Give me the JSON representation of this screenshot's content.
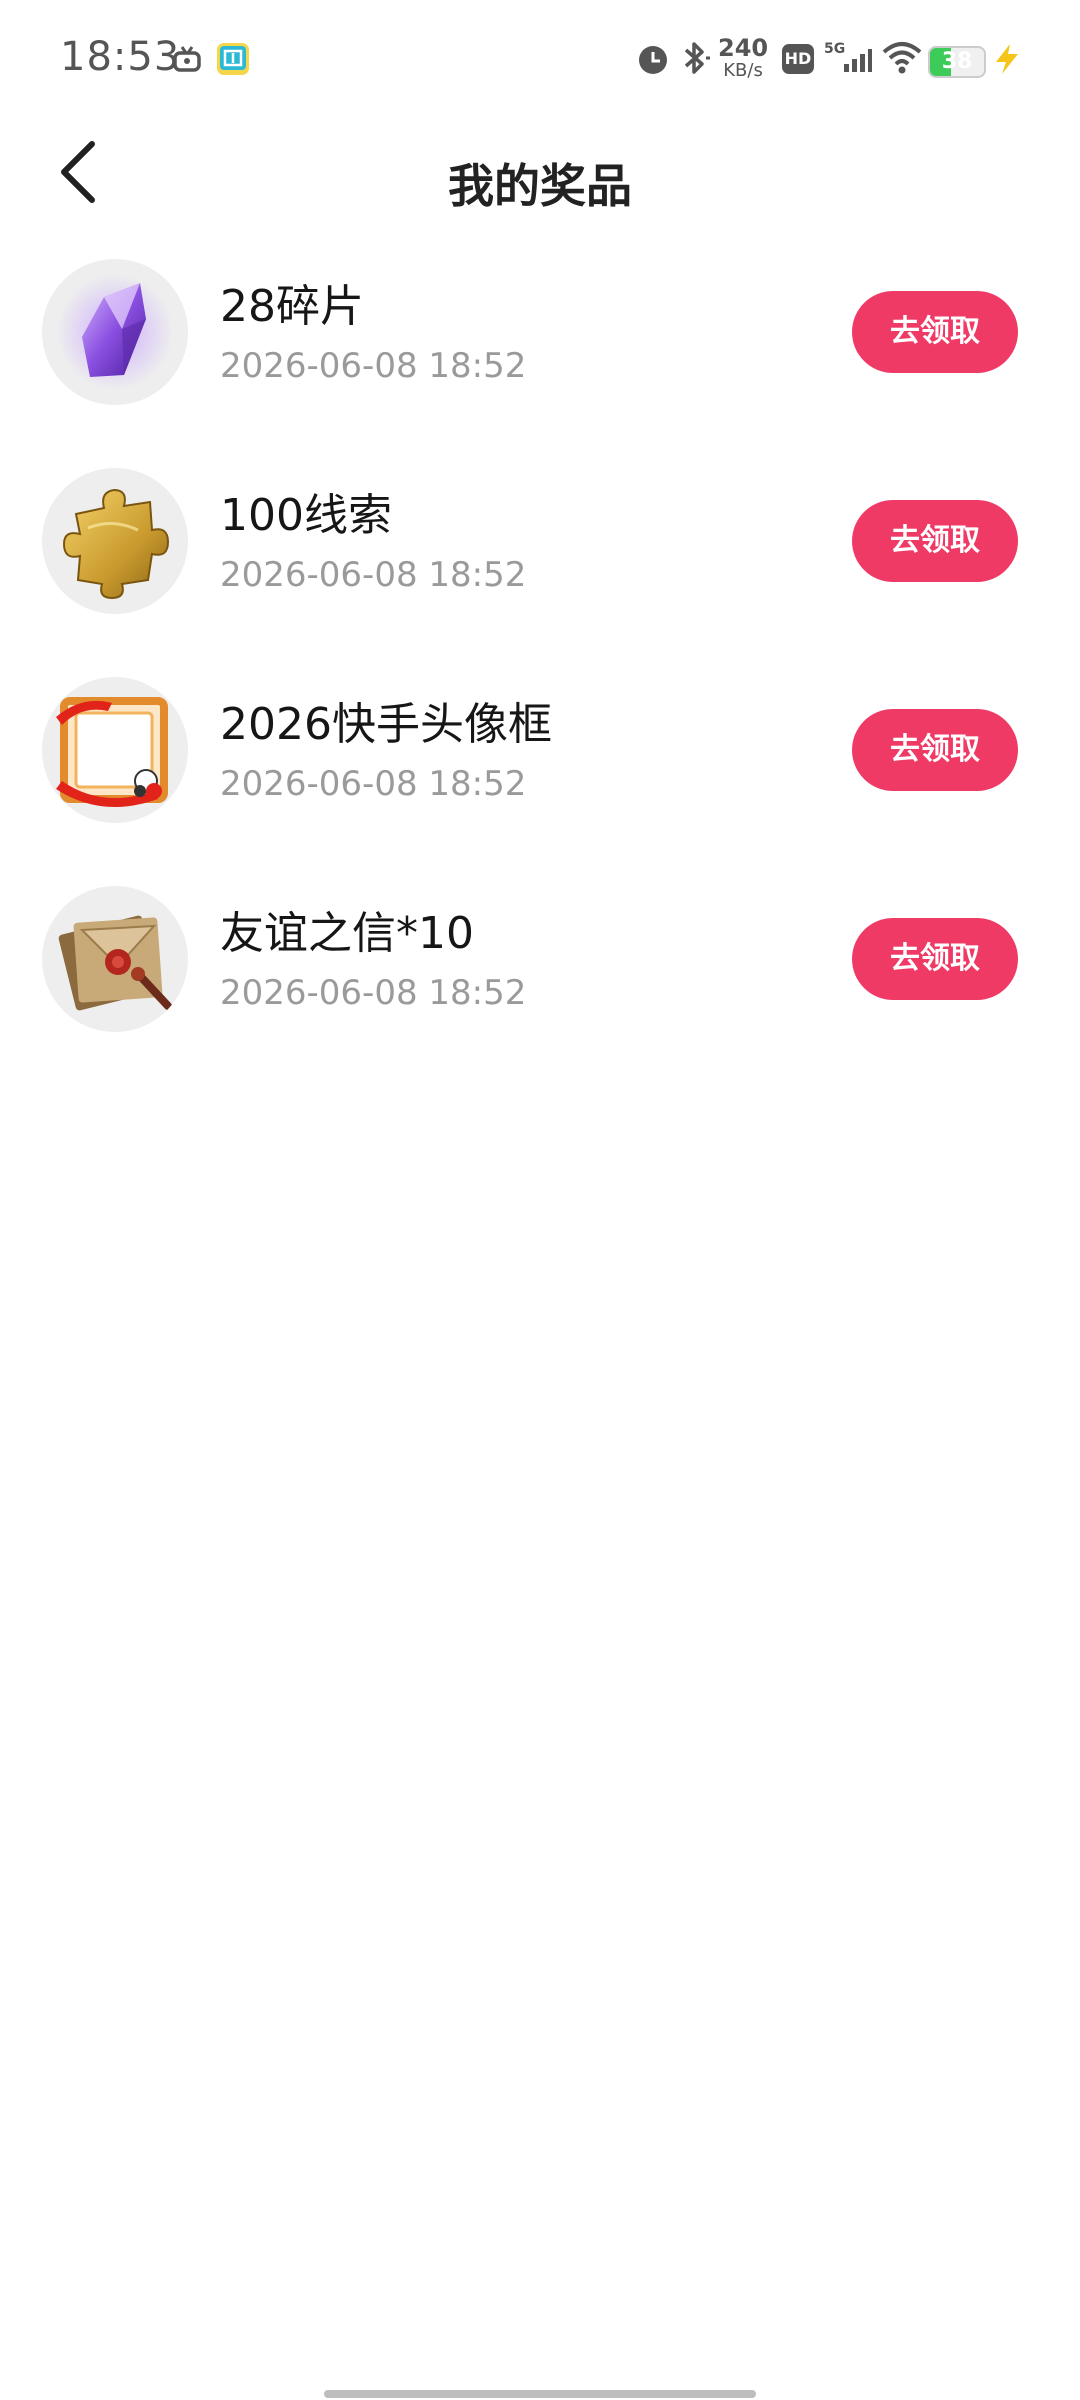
{
  "status_bar": {
    "time": "18:53",
    "net_speed_value": "240",
    "net_speed_unit": "KB/s",
    "hd_label": "HD",
    "network_label": "5G",
    "battery_level": "38",
    "battery_fill_percent": 38,
    "icons": [
      "tv-icon",
      "app-icon",
      "alarm-icon",
      "bluetooth-icon",
      "hd-icon",
      "signal-icon",
      "wifi-icon",
      "battery-icon",
      "charging-icon"
    ]
  },
  "header": {
    "title": "我的奖品",
    "back_icon": "chevron-left-icon"
  },
  "prizes": [
    {
      "name": "28碎片",
      "date": "2026-06-08 18:52",
      "button": "去领取",
      "icon": "purple-crystal-icon"
    },
    {
      "name": "100线索",
      "date": "2026-06-08 18:52",
      "button": "去领取",
      "icon": "gold-puzzle-icon"
    },
    {
      "name": "2026快手头像框",
      "date": "2026-06-08 18:52",
      "button": "去领取",
      "icon": "avatar-frame-icon"
    },
    {
      "name": "友谊之信*10",
      "date": "2026-06-08 18:52",
      "button": "去领取",
      "icon": "sealed-letter-icon"
    }
  ],
  "colors": {
    "accent": "#f03a66",
    "date_text": "#9a9a9a",
    "thumb_bg": "#eeeeee",
    "battery_green": "#3dcc5a",
    "charging_yellow": "#f5c518"
  }
}
